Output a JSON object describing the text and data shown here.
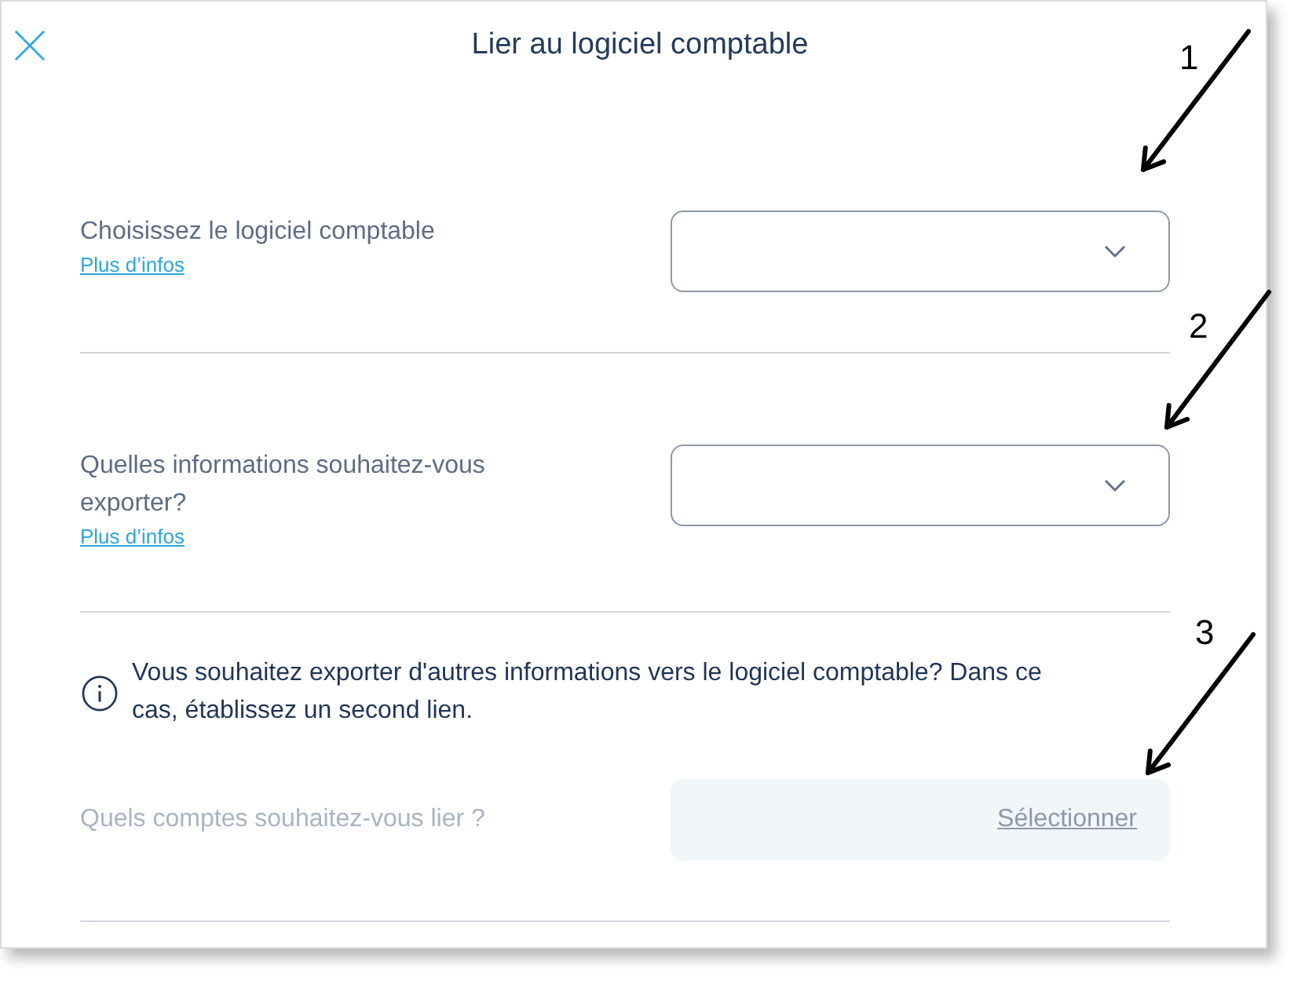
{
  "dialog": {
    "title": "Lier au logiciel comptable"
  },
  "rows": [
    {
      "kind": "dropdown",
      "label": "Choisissez le logiciel comptable",
      "link": "Plus d’infos"
    },
    {
      "kind": "dropdown",
      "label": "Quelles informations souhaitez-vous exporter?",
      "link": "Plus d’infos"
    },
    {
      "kind": "notice",
      "text": "Vous souhaitez exporter d'autres informations vers le logiciel comptable? Dans ce cas, établissez un second lien."
    },
    {
      "kind": "picker",
      "label": "Quels comptes souhaitez-vous lier ?",
      "action": "Sélectionner",
      "disabled": true
    }
  ],
  "annotations": [
    {
      "label": "1"
    },
    {
      "label": "2"
    },
    {
      "label": "3"
    }
  ]
}
